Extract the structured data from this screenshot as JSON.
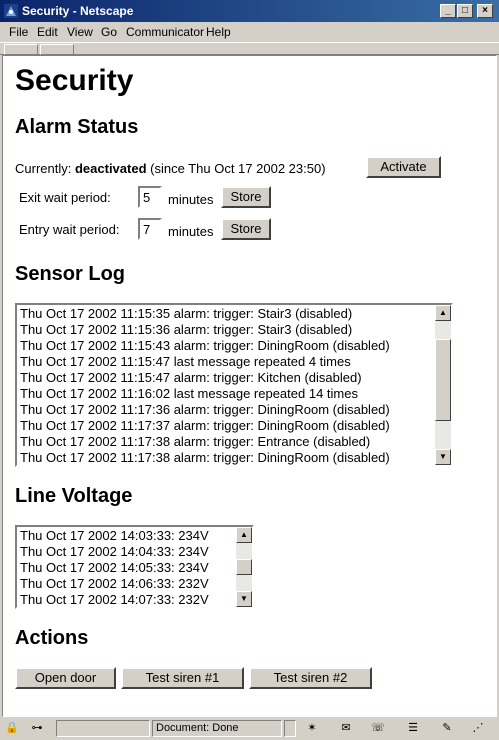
{
  "window": {
    "title": "Security - Netscape",
    "controls": {
      "minimize": "_",
      "maximize": "□",
      "close": "×"
    }
  },
  "menu": {
    "items": [
      "File",
      "Edit",
      "View",
      "Go",
      "Communicator",
      "Help"
    ]
  },
  "page": {
    "title": "Security",
    "alarm": {
      "heading": "Alarm Status",
      "currently_label": "Currently:",
      "state": "deactivated",
      "since": "(since Thu Oct 17 2002 23:50)",
      "activate_label": "Activate",
      "exit_label": "Exit wait period:",
      "exit_value": "5",
      "entry_label": "Entry wait period:",
      "entry_value": "7",
      "minutes_label": "minutes",
      "store_label": "Store"
    },
    "sensor_log": {
      "heading": "Sensor Log",
      "entries": [
        "Thu Oct 17 2002 11:15:35 alarm: trigger: Stair3 (disabled)",
        "Thu Oct 17 2002 11:15:36 alarm: trigger: Stair3 (disabled)",
        "Thu Oct 17 2002 11:15:43 alarm: trigger: DiningRoom (disabled)",
        "Thu Oct 17 2002 11:15:47 last message repeated 4 times",
        "Thu Oct 17 2002 11:15:47 alarm: trigger: Kitchen (disabled)",
        "Thu Oct 17 2002 11:16:02 last message repeated 14 times",
        "Thu Oct 17 2002 11:17:36 alarm: trigger: DiningRoom (disabled)",
        "Thu Oct 17 2002 11:17:37 alarm: trigger: DiningRoom (disabled)",
        "Thu Oct 17 2002 11:17:38 alarm: trigger: Entrance (disabled)",
        "Thu Oct 17 2002 11:17:38 alarm: trigger: DiningRoom (disabled)"
      ]
    },
    "line_voltage": {
      "heading": "Line Voltage",
      "entries": [
        "Thu Oct 17 2002 14:03:33: 234V",
        "Thu Oct 17 2002 14:04:33: 234V",
        "Thu Oct 17 2002 14:05:33: 234V",
        "Thu Oct 17 2002 14:06:33: 232V",
        "Thu Oct 17 2002 14:07:33: 232V"
      ]
    },
    "actions": {
      "heading": "Actions",
      "open_door": "Open door",
      "test_siren_1": "Test siren #1",
      "test_siren_2": "Test siren #2"
    }
  },
  "status": {
    "text": "Document: Done"
  },
  "colors": {
    "titlebar_start": "#0a246a",
    "titlebar_end": "#3a6ea5",
    "chrome": "#d4d0c8"
  }
}
